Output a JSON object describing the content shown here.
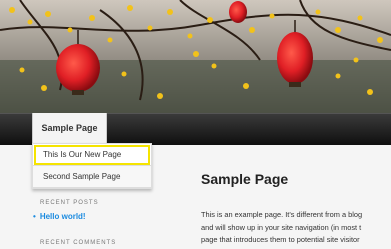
{
  "nav": {
    "active_item": "Sample Page",
    "dropdown": [
      "This Is Our New Page",
      "Second Sample Page"
    ]
  },
  "sidebar": {
    "recent_posts_heading": "RECENT POSTS",
    "recent_posts": [
      "Hello world!"
    ],
    "recent_comments_heading": "RECENT COMMENTS"
  },
  "content": {
    "title": "Sample Page",
    "lines": [
      "This is an example page. It's different from a blog",
      "and will show up in your site navigation (in most t",
      "page that introduces them to potential site visitor"
    ]
  },
  "colors": {
    "highlight": "#f5e400",
    "link": "#1b8be0",
    "lantern": "#e01f25"
  }
}
